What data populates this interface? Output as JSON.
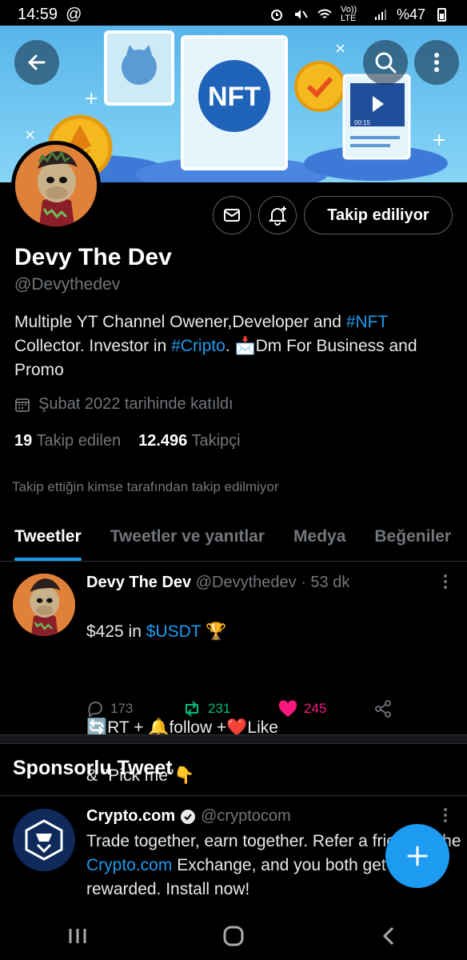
{
  "status_bar": {
    "time": "14:59",
    "at_symbol": "@",
    "network": "Vo)) LTE",
    "battery": "%47"
  },
  "colors": {
    "accent": "#1d9bf0",
    "retweet": "#00ba7c",
    "like": "#f91880",
    "background": "#000000",
    "muted": "#71767b"
  },
  "banner": {
    "nft_label": "NFT",
    "video_time": "00:15"
  },
  "profile": {
    "name": "Devy The Dev",
    "handle": "@Devythedev",
    "bio_part1": "Multiple YT Channel Owener,Developer and ",
    "bio_tag1": "#NFT",
    "bio_part2": " Collector. Investor in ",
    "bio_tag2": "#Cripto",
    "bio_part3": ".    📩Dm For Business and Promo",
    "joined": "Şubat 2022 tarihinde katıldı",
    "following_count": "19",
    "following_label": "Takip edilen",
    "followers_count": "12.496",
    "followers_label": "Takipçi",
    "followed_by": "Takip ettiğin kimse tarafından takip edilmiyor",
    "follow_button": "Takip ediliyor"
  },
  "tabs": [
    "Tweetler",
    "Tweetler ve yanıtlar",
    "Medya",
    "Beğeniler"
  ],
  "tweet": {
    "author": "Devy The Dev",
    "handle": "@Devythedev",
    "time": "· 53 dk",
    "line1_pre": "$425 in ",
    "line1_tag": "$USDT",
    "line1_post": " 🏆",
    "line2": "🔄RT + 🔔follow +❤️Like",
    "line3": " & \"Pick me\"👇",
    "replies": "173",
    "retweets": "231",
    "likes": "245"
  },
  "sponsored": {
    "title": "Sponsorlu Tweet",
    "author": "Crypto.com",
    "handle": "@cryptocom",
    "body_part1": "Trade together, earn together. Refer a friend to the ",
    "body_link": "Crypto.com",
    "body_part2": " Exchange, and you both get rewarded. Install now!"
  }
}
